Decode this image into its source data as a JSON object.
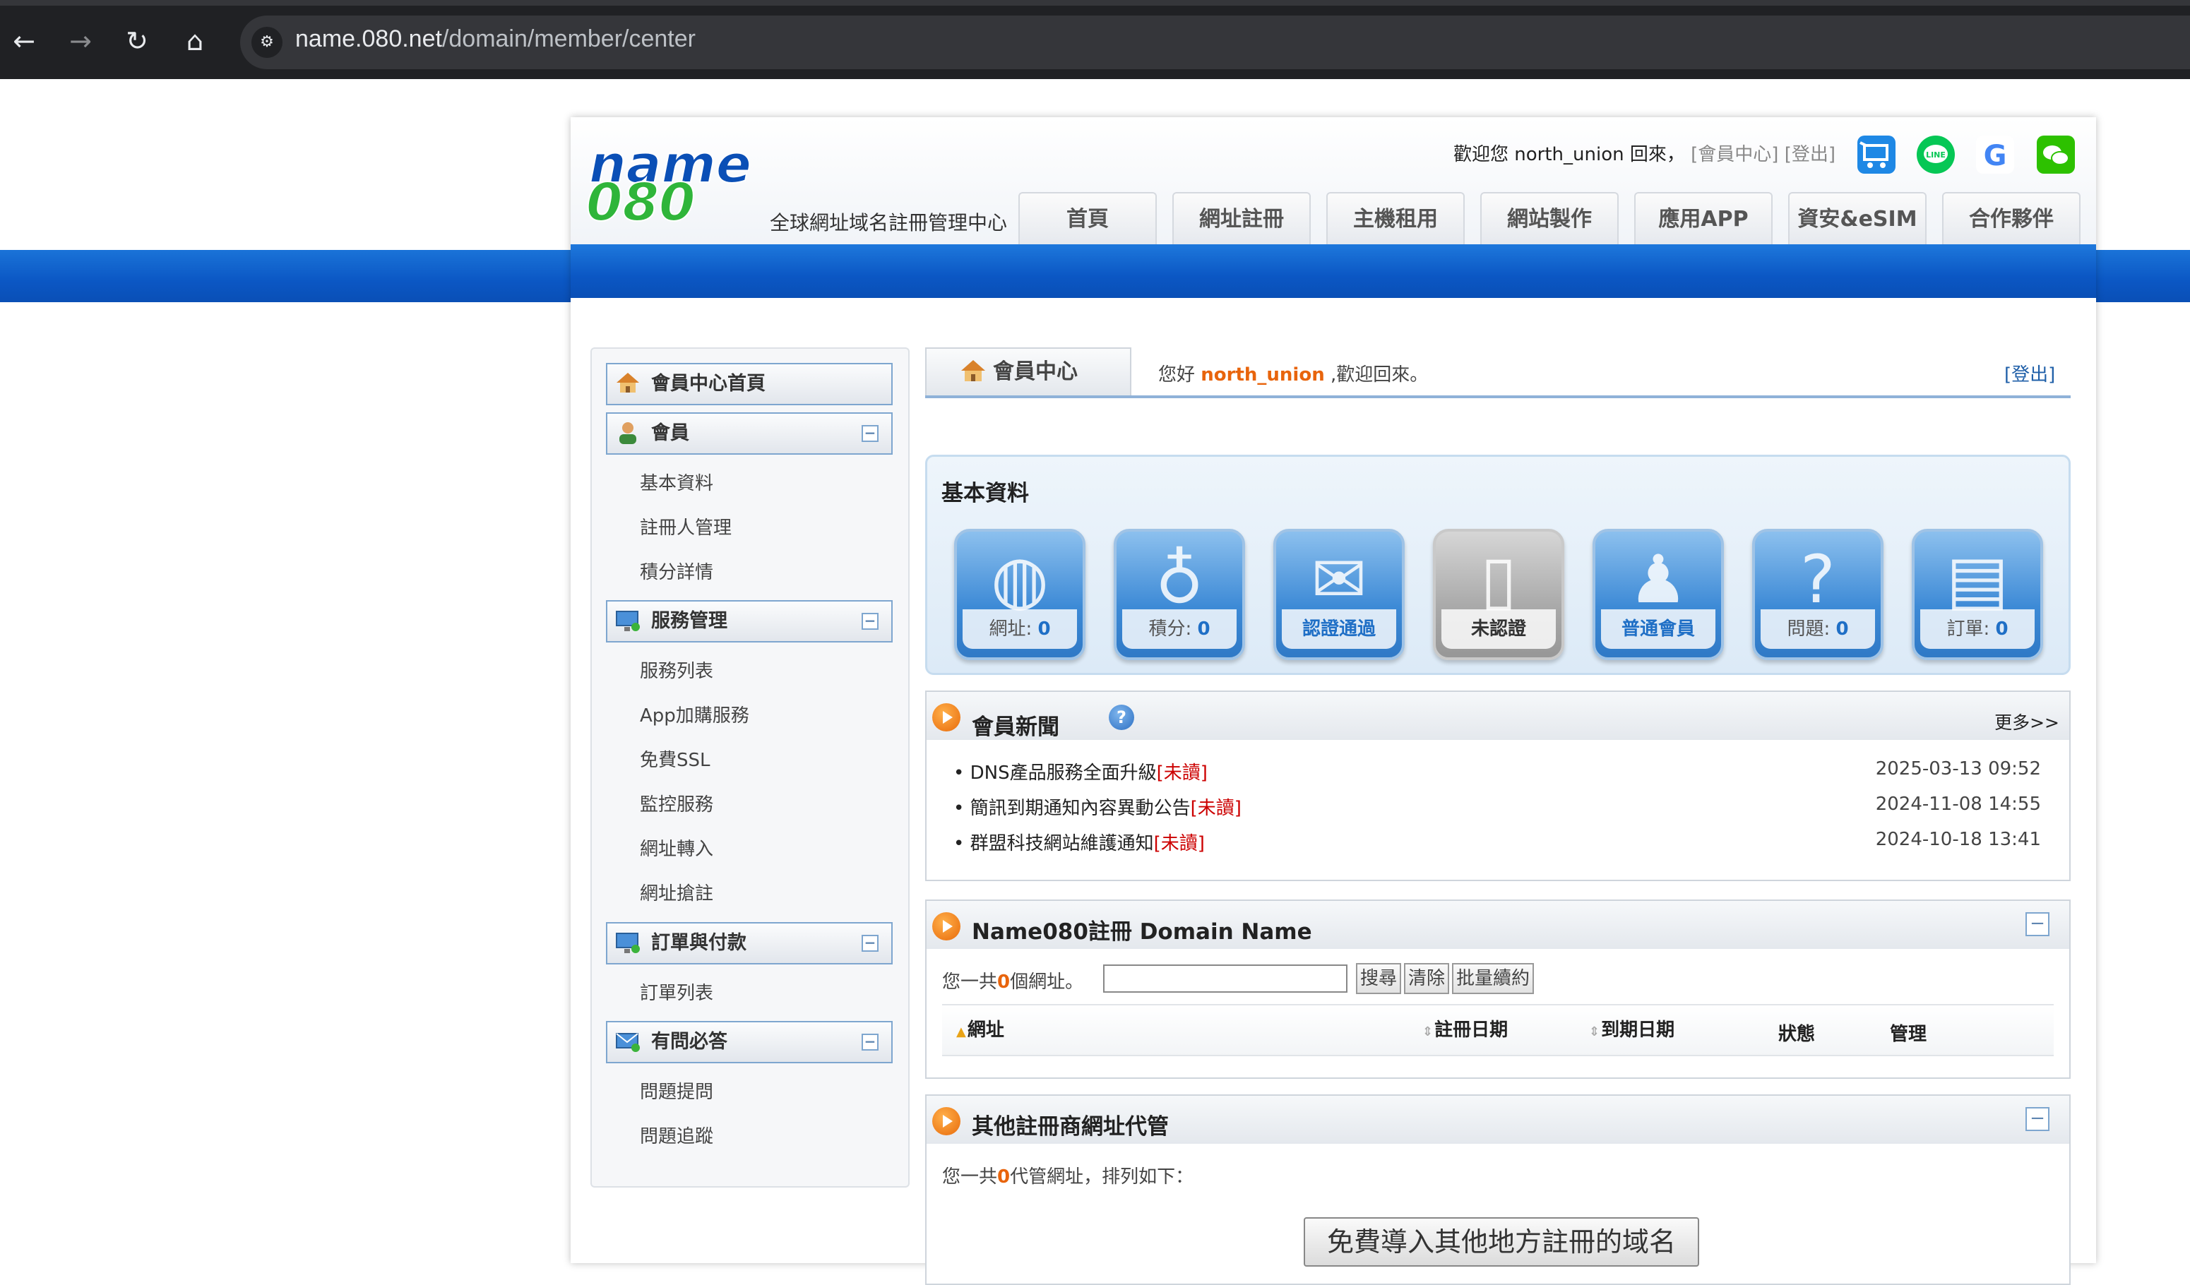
{
  "browser": {
    "url_domain": "name.080.net",
    "url_path": "/domain/member/center",
    "back_icon": "←",
    "forward_icon": "→",
    "reload_icon": "↻",
    "home_icon": "⌂"
  },
  "header": {
    "logo_text": "name 080",
    "logo_sub": "全球網址域名註冊管理中心",
    "welcome_prefix": "歡迎您 north_union 回來，",
    "member_center_link": "[會員中心]",
    "logout_link": "[登出]",
    "nav": [
      "首頁",
      "網址註冊",
      "主機租用",
      "網站製作",
      "應用APP",
      "資安&eSIM",
      "合作夥伴"
    ],
    "icons": [
      "cart-icon",
      "line-icon",
      "google-icon",
      "wechat-icon"
    ]
  },
  "sidebar": {
    "home": "會員中心首頁",
    "sections": [
      {
        "title": "會員",
        "items": [
          "基本資料",
          "註冊人管理",
          "積分詳情"
        ]
      },
      {
        "title": "服務管理",
        "items": [
          "服務列表",
          "App加購服務",
          "免費SSL",
          "監控服務",
          "網址轉入",
          "網址搶註"
        ]
      },
      {
        "title": "訂單與付款",
        "items": [
          "訂單列表"
        ]
      },
      {
        "title": "有問必答",
        "items": [
          "問題提問",
          "問題追蹤"
        ]
      }
    ],
    "toggle": "−"
  },
  "main": {
    "tab_label": "會員中心",
    "hello_prefix": "您好 ",
    "hello_user": "north_union",
    "hello_suffix": " ,歡迎回來。",
    "logout": "[登出]",
    "basic": {
      "title": "基本資料",
      "stats": [
        {
          "label": "網址: ",
          "value": "0",
          "icon": "globe-icon"
        },
        {
          "label": "積分: ",
          "value": "0",
          "icon": "medal-icon"
        },
        {
          "label": "",
          "value": "認證通過",
          "icon": "mail-icon"
        },
        {
          "label": "未認證",
          "value": "",
          "icon": "phone-icon"
        },
        {
          "label": "",
          "value": "普通會員",
          "icon": "person-icon"
        },
        {
          "label": "問題: ",
          "value": "0",
          "icon": "question-icon"
        },
        {
          "label": "訂單: ",
          "value": "0",
          "icon": "document-icon"
        }
      ]
    },
    "news": {
      "title": "會員新聞",
      "more": "更多>>",
      "items": [
        {
          "text": "DNS產品服務全面升級",
          "tag": "[未讀]",
          "date": "2025-03-13 09:52"
        },
        {
          "text": "簡訊到期通知內容異動公告",
          "tag": "[未讀]",
          "date": "2024-11-08 14:55"
        },
        {
          "text": "群盟科技網站維護通知",
          "tag": "[未讀]",
          "date": "2024-10-18 13:41"
        }
      ]
    },
    "domains": {
      "title": "Name080註冊 Domain Name",
      "count_prefix": "您一共",
      "count": "0",
      "count_suffix": "個網址。",
      "buttons": [
        "搜尋",
        "清除",
        "批量續約"
      ],
      "columns": [
        "網址",
        "註冊日期",
        "到期日期",
        "狀態",
        "管理"
      ]
    },
    "other": {
      "title": "其他註冊商網址代管",
      "count_prefix": "您一共",
      "count": "0",
      "count_suffix": "代管網址，排列如下：",
      "import_button": "免費導入其他地方註冊的域名"
    }
  }
}
